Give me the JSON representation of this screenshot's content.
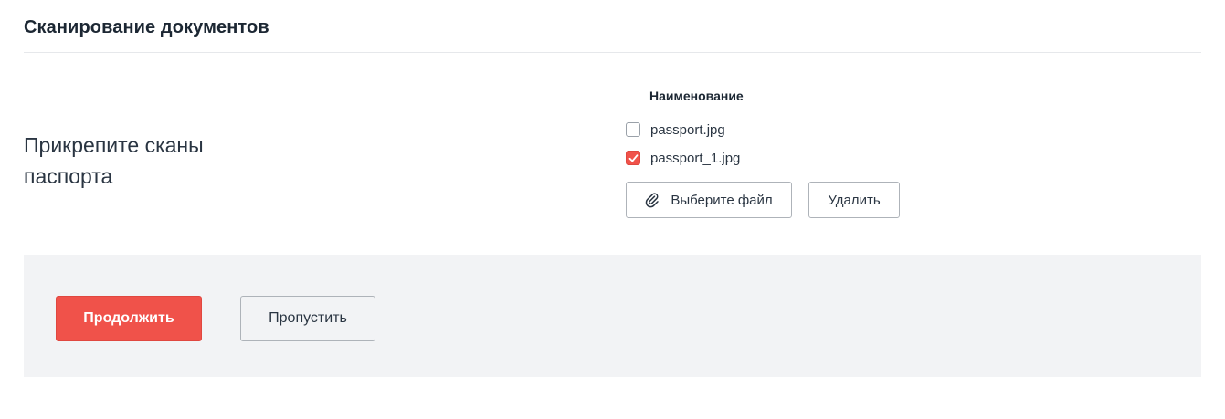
{
  "header": {
    "title": "Сканирование документов"
  },
  "prompt": {
    "text": "Прикрепите сканы паспорта"
  },
  "files": {
    "column_header": "Наименование",
    "items": [
      {
        "name": "passport.jpg",
        "checked": false
      },
      {
        "name": "passport_1.jpg",
        "checked": true
      }
    ],
    "choose_label": "Выберите файл",
    "choose_icon": "paperclip-icon",
    "delete_label": "Удалить"
  },
  "footer": {
    "continue_label": "Продолжить",
    "skip_label": "Пропустить"
  },
  "colors": {
    "accent": "#f0524a",
    "footer_bg": "#f2f3f5"
  }
}
